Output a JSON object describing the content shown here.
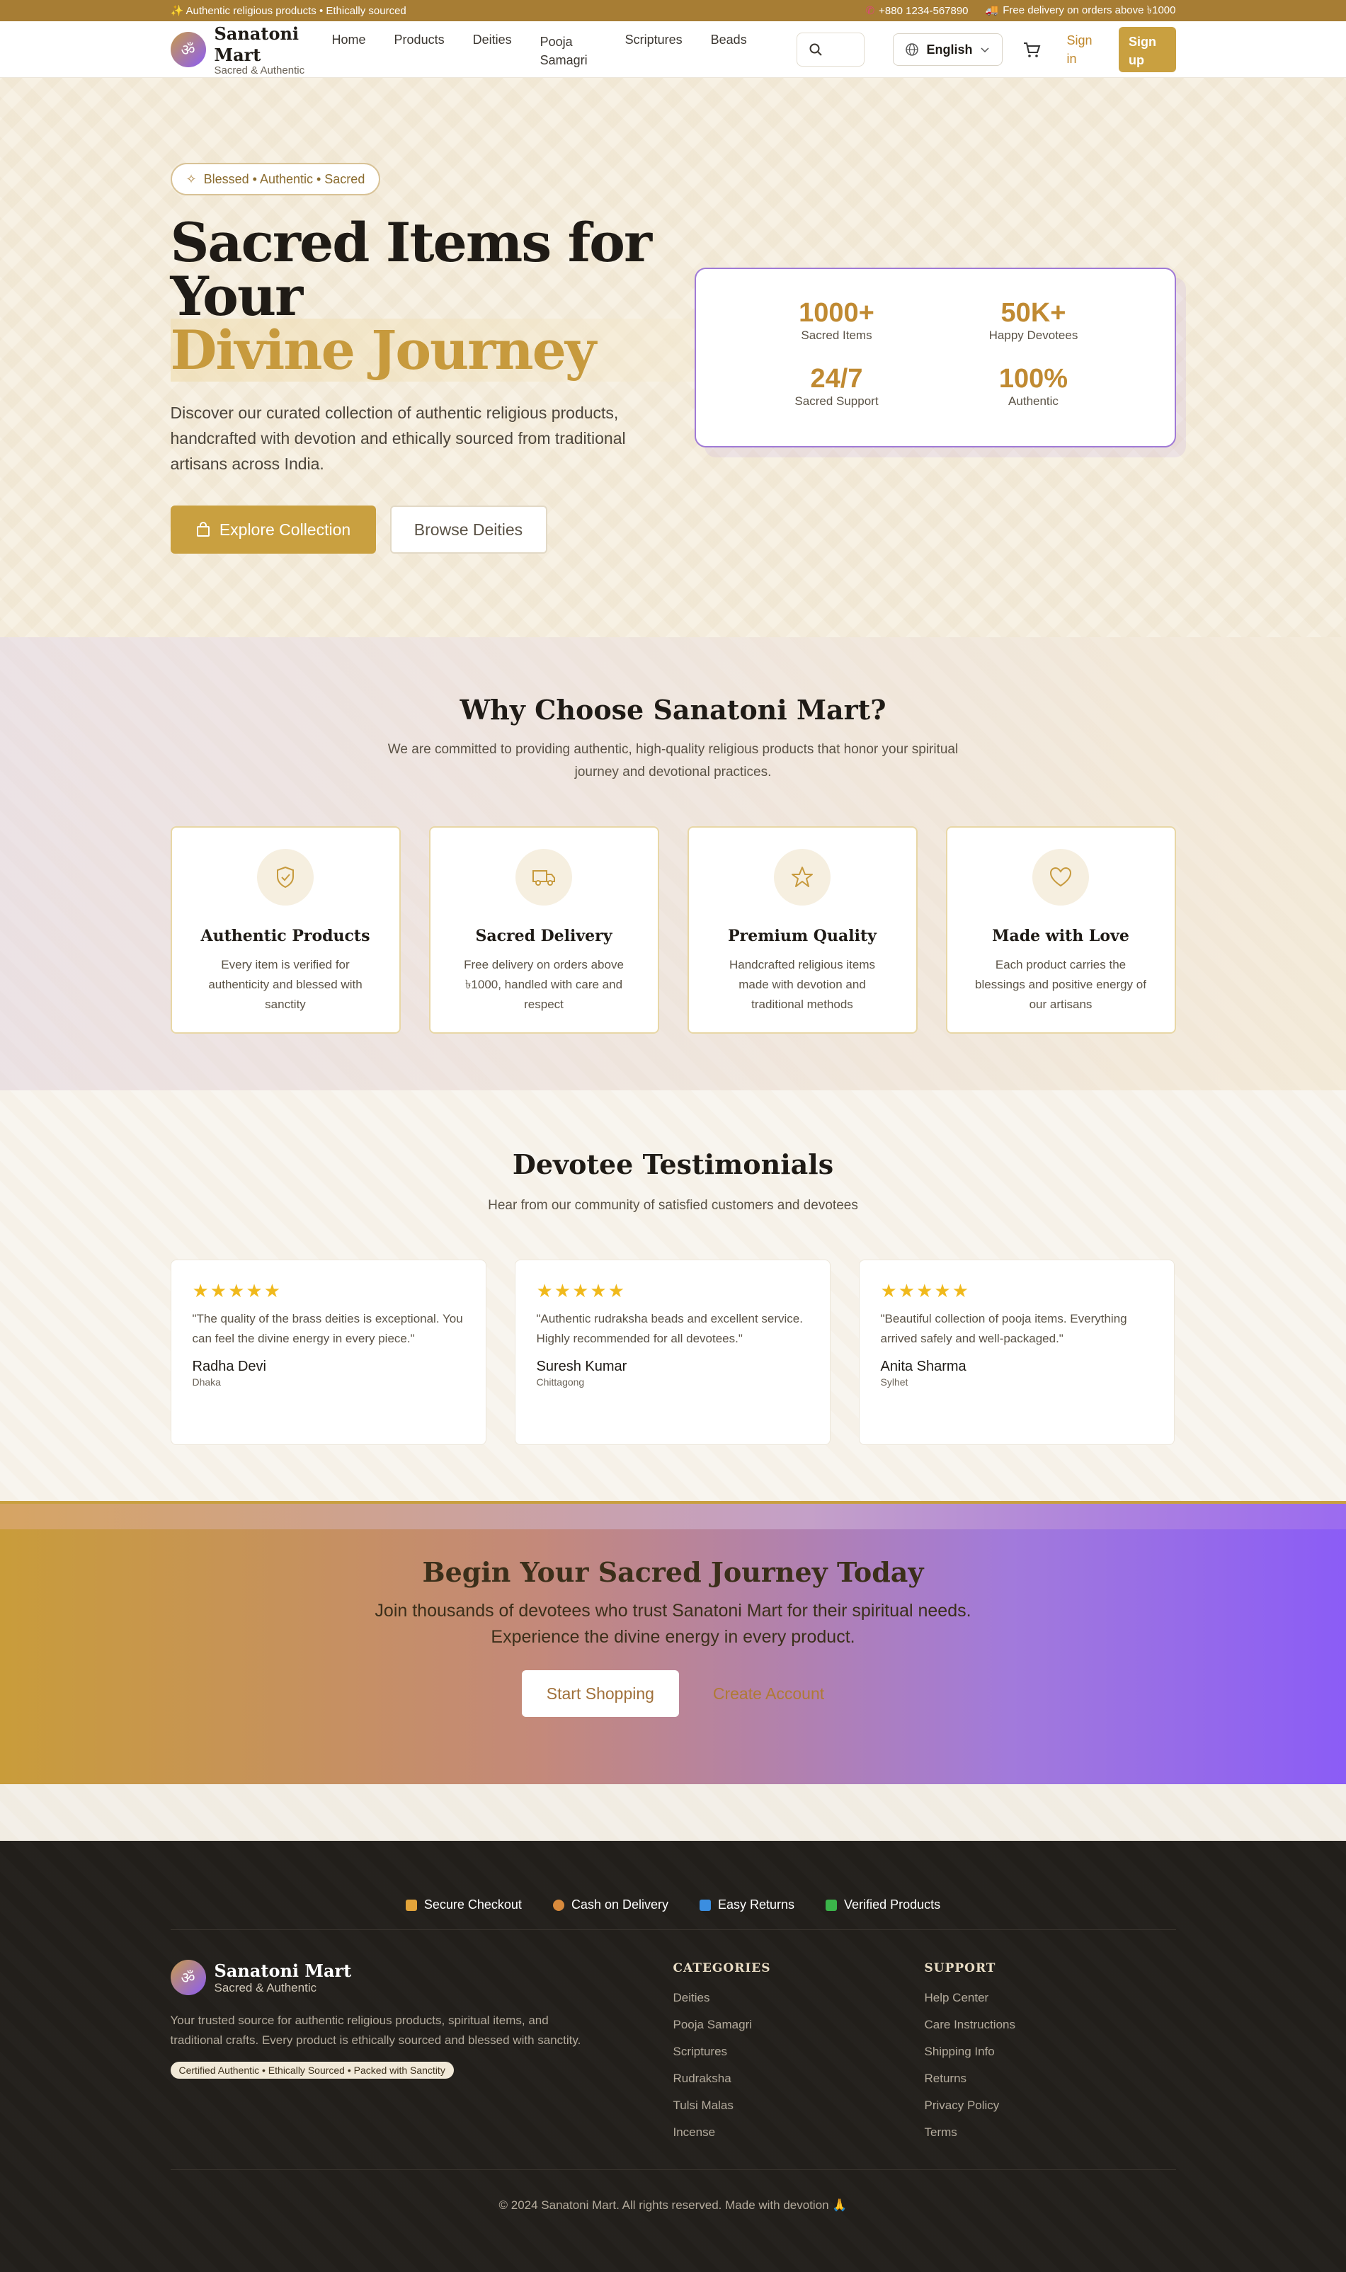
{
  "topbar": {
    "left": "✨ Authentic religious products • Ethically sourced",
    "phone": "+880 1234-567890",
    "delivery": "Free delivery on orders above ৳1000"
  },
  "header": {
    "logo_glyph": "ॐ",
    "brand_name": "Sanatoni Mart",
    "brand_tag": "Sacred & Authentic",
    "nav": [
      "Home",
      "Products",
      "Deities",
      "Pooja Samagri",
      "Scriptures",
      "Beads"
    ],
    "language": "English",
    "signin": "Sign in",
    "signup": "Sign up"
  },
  "hero": {
    "badge": "Blessed • Authentic • Sacred",
    "title_line1": "Sacred Items for",
    "title_line2": "Your",
    "title_gold": "Divine Journey",
    "lead": "Discover our curated collection of authentic religious products, handcrafted with devotion and ethically sourced from traditional artisans across India.",
    "btn_explore": "Explore Collection",
    "btn_browse": "Browse Deities",
    "stats": [
      {
        "value": "1000+",
        "label": "Sacred Items"
      },
      {
        "value": "50K+",
        "label": "Happy Devotees"
      },
      {
        "value": "24/7",
        "label": "Sacred Support"
      },
      {
        "value": "100%",
        "label": "Authentic"
      }
    ]
  },
  "why": {
    "title": "Why Choose Sanatoni Mart?",
    "subtitle": "We are committed to providing authentic, high-quality religious products that honor your spiritual journey and devotional practices.",
    "features": [
      {
        "title": "Authentic Products",
        "desc": "Every item is verified for authenticity and blessed with sanctity"
      },
      {
        "title": "Sacred Delivery",
        "desc": "Free delivery on orders above ৳1000, handled with care and respect"
      },
      {
        "title": "Premium Quality",
        "desc": "Handcrafted religious items made with devotion and traditional methods"
      },
      {
        "title": "Made with Love",
        "desc": "Each product carries the blessings and positive energy of our artisans"
      }
    ]
  },
  "testimonials": {
    "title": "Devotee Testimonials",
    "subtitle": "Hear from our community of satisfied customers and devotees",
    "items": [
      {
        "stars": "★★★★★",
        "quote": "\"The quality of the brass deities is exceptional. You can feel the divine energy in every piece.\"",
        "name": "Radha Devi",
        "city": "Dhaka"
      },
      {
        "stars": "★★★★★",
        "quote": "\"Authentic rudraksha beads and excellent service. Highly recommended for all devotees.\"",
        "name": "Suresh Kumar",
        "city": "Chittagong"
      },
      {
        "stars": "★★★★★",
        "quote": "\"Beautiful collection of pooja items. Everything arrived safely and well-packaged.\"",
        "name": "Anita Sharma",
        "city": "Sylhet"
      }
    ]
  },
  "cta": {
    "title": "Begin Your Sacred Journey Today",
    "text": "Join thousands of devotees who trust Sanatoni Mart for their spiritual needs. Experience the divine energy in every product.",
    "btn_shop": "Start Shopping",
    "btn_account": "Create Account"
  },
  "footer": {
    "trust": [
      "Secure Checkout",
      "Cash on Delivery",
      "Easy Returns",
      "Verified Products"
    ],
    "brand_name": "Sanatoni Mart",
    "brand_tag": "Sacred & Authentic",
    "desc": "Your trusted source for authentic religious products, spiritual items, and traditional crafts. Every product is ethically sourced and blessed with sanctity.",
    "pill": "Certified Authentic • Ethically Sourced • Packed with Sanctity",
    "categories_title": "CATEGORIES",
    "categories": [
      "Deities",
      "Pooja Samagri",
      "Scriptures",
      "Rudraksha",
      "Tulsi Malas",
      "Incense"
    ],
    "support_title": "SUPPORT",
    "support": [
      "Help Center",
      "Care Instructions",
      "Shipping Info",
      "Returns",
      "Privacy Policy",
      "Terms"
    ],
    "copyright": "© 2024 Sanatoni Mart. All rights reserved. Made with devotion 🙏"
  },
  "colors": {
    "gold": "#c9a040",
    "purple": "#8b5cf6",
    "dark": "#221f1b"
  }
}
